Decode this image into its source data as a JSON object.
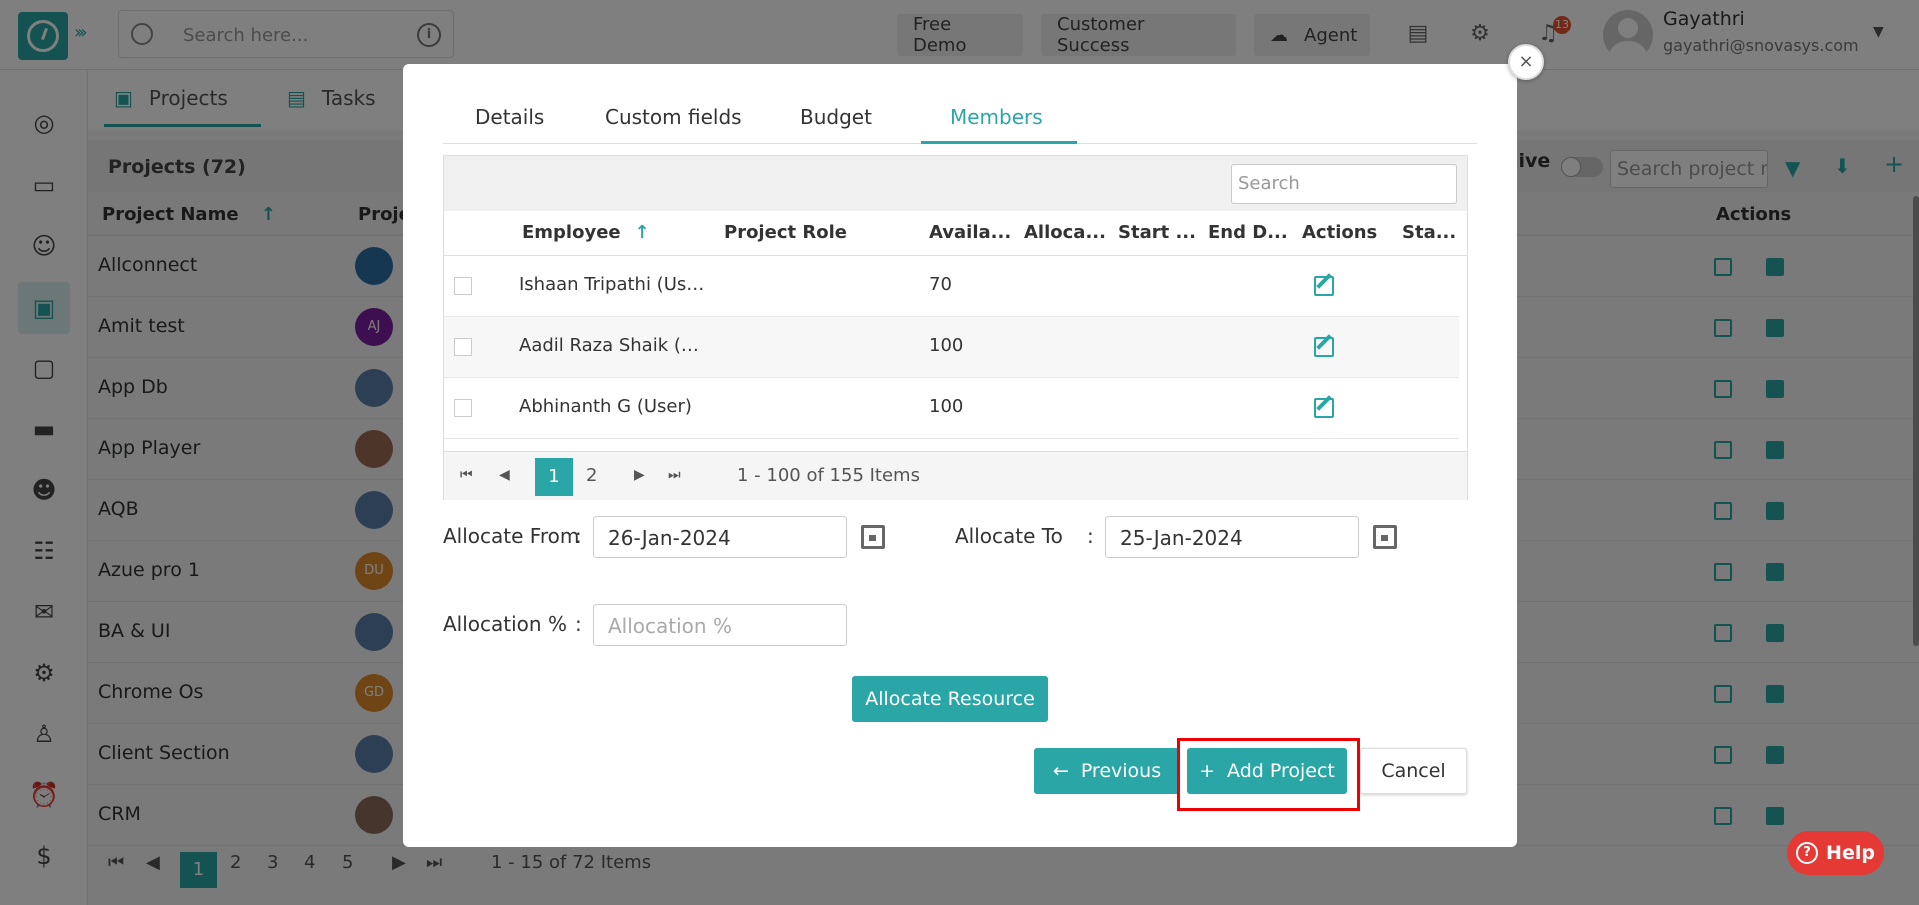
{
  "topbar": {
    "search_placeholder": "Search here...",
    "free_demo": "Free Demo",
    "customer_success": "Customer Success",
    "agent": "Agent",
    "notification_count": "13",
    "user_name": "Gayathri",
    "user_email": "gayathri@snovasys.com"
  },
  "page_tabs": [
    "Projects",
    "Tasks"
  ],
  "projects": {
    "title": "Projects (72)",
    "col_name": "Project Name",
    "col_project": "Proje",
    "col_actions": "Actions",
    "archive_label": "hive",
    "search_placeholder": "Search project n...",
    "rows": [
      {
        "name": "Allconnect",
        "avatar": "",
        "color": "#2b6ea3"
      },
      {
        "name": "Amit test",
        "avatar": "AJ",
        "color": "#7b1fa2"
      },
      {
        "name": "App Db",
        "avatar": "",
        "color": "#5a7fa8"
      },
      {
        "name": "App Player",
        "avatar": "",
        "color": "#9c6b55"
      },
      {
        "name": "AQB",
        "avatar": "",
        "color": "#5a7fa8"
      },
      {
        "name": "Azue pro 1",
        "avatar": "DU",
        "color": "#e08a2c"
      },
      {
        "name": "BA & UI",
        "avatar": "",
        "color": "#5a7fa8"
      },
      {
        "name": "Chrome Os",
        "avatar": "GD",
        "color": "#e08a2c"
      },
      {
        "name": "Client Section",
        "avatar": "",
        "color": "#5a7fa8"
      },
      {
        "name": "CRM",
        "avatar": "",
        "color": "#8a6a5a"
      }
    ],
    "pager_pages": [
      "1",
      "2",
      "3",
      "4",
      "5"
    ],
    "pager_info": "1 - 15 of 72 Items"
  },
  "modal": {
    "tabs": [
      "Details",
      "Custom fields",
      "Budget",
      "Members"
    ],
    "active_tab": "Members",
    "grid": {
      "search_placeholder": "Search",
      "columns": [
        "Employee",
        "Project Role",
        "Availa...",
        "Alloca...",
        "Start ...",
        "End D...",
        "Actions",
        "Sta..."
      ],
      "rows": [
        {
          "employee": "Ishaan Tripathi (Use...",
          "available": "70"
        },
        {
          "employee": "Aadil Raza Shaik (U...",
          "available": "100"
        },
        {
          "employee": "Abhinanth G (User)",
          "available": "100"
        }
      ],
      "pages": [
        "1",
        "2"
      ],
      "pager_info": "1 - 100 of 155 Items"
    },
    "allocate_from_label": "Allocate From",
    "allocate_from_value": "26-Jan-2024",
    "allocate_to_label": "Allocate To",
    "allocate_to_value": "25-Jan-2024",
    "allocation_label": "Allocation %",
    "allocation_placeholder": "Allocation %",
    "colon": ":",
    "allocate_button": "Allocate Resource",
    "previous_button": "Previous",
    "add_project_button": "Add Project",
    "cancel_button": "Cancel"
  },
  "help": "Help",
  "colors": {
    "accent": "#2aa6a6",
    "highlight": "#e00000",
    "help": "#e53935"
  }
}
